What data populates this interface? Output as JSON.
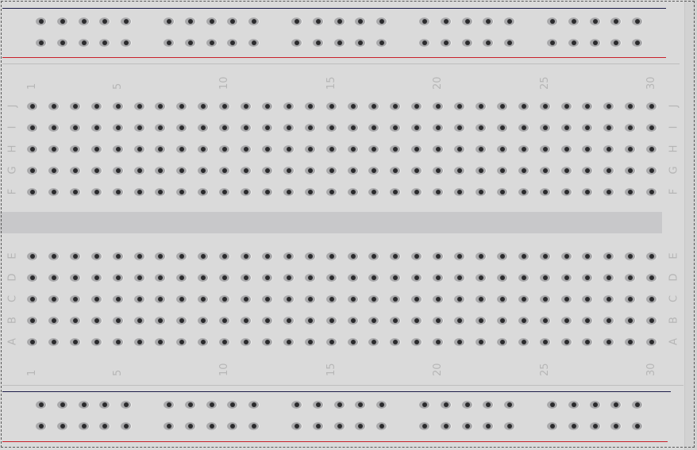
{
  "breadboard": {
    "columns": 30,
    "top_rows": [
      "J",
      "I",
      "H",
      "G",
      "F"
    ],
    "bottom_rows": [
      "E",
      "D",
      "C",
      "B",
      "A"
    ],
    "column_labels": [
      "1",
      "5",
      "10",
      "15",
      "20",
      "25",
      "30"
    ],
    "power_rail_groups": 5,
    "holes_per_rail_group": 5,
    "colors": {
      "board": "#dadada",
      "positive_rail": "#c8202a",
      "negative_rail": "#1d1d4a",
      "label": "#b6b6b6"
    }
  }
}
